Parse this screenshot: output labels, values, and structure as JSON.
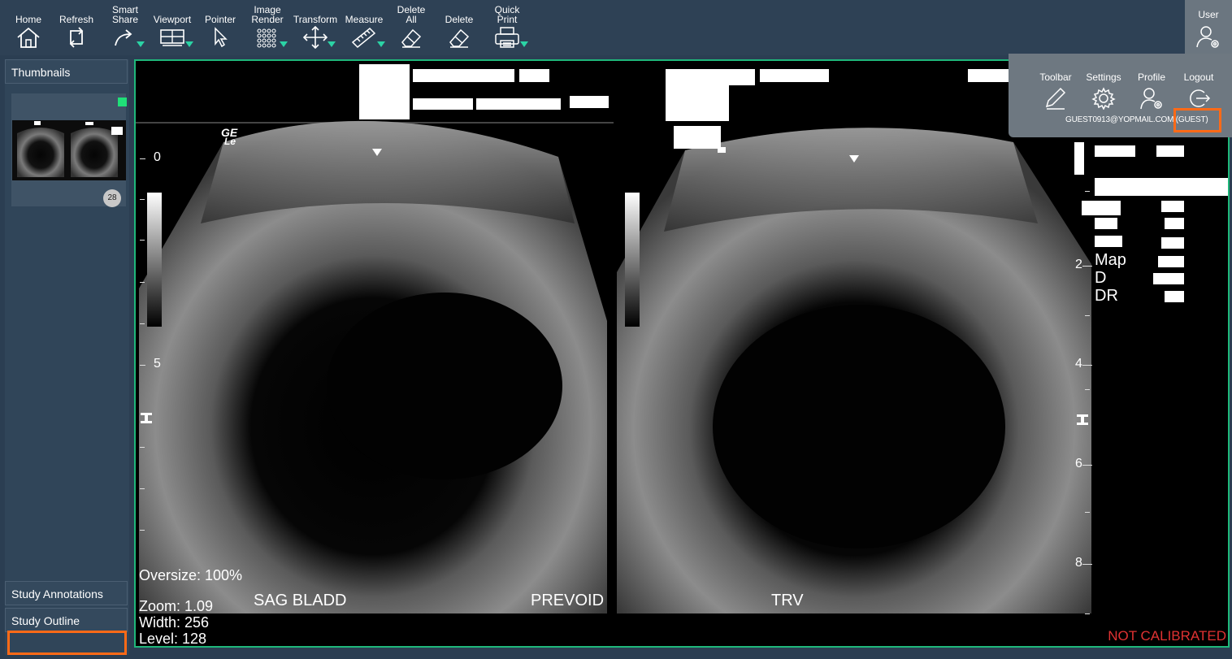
{
  "toolbar": {
    "home": "Home",
    "refresh": "Refresh",
    "smart_share": "Smart\nShare",
    "viewport": "Viewport",
    "pointer": "Pointer",
    "image_render": "Image\nRender",
    "transform": "Transform",
    "measure": "Measure",
    "delete_all": "Delete\nAll",
    "delete": "Delete",
    "quick_print": "Quick\nPrint",
    "user": "User"
  },
  "user_menu": {
    "toolbar": "Toolbar",
    "settings": "Settings",
    "profile": "Profile",
    "logout": "Logout",
    "email": "GUEST0913@YOPMAIL.COM (GUEST)"
  },
  "left_panel": {
    "thumbnails": "Thumbnails",
    "thumb_count": "28",
    "study_annotations": "Study Annotations",
    "study_outline": "Study Outline"
  },
  "viewer": {
    "vendor_logo": "GE",
    "vendor_sub": "Le",
    "oversize": "Oversize: 100%",
    "zoom": "Zoom: 1.09",
    "width": "Width: 256",
    "level": "Level: 128",
    "label_left": "SAG BLADD",
    "label_prevoid": "PREVOID",
    "label_right": "TRV",
    "left_scale": [
      "0",
      "5"
    ],
    "right_scale": [
      "2",
      "4",
      "6",
      "8"
    ],
    "param_labels": [
      "Map",
      "D",
      "DR"
    ],
    "not_calibrated": "NOT CALIBRATED",
    "colors": {
      "frame": "#1fb77a",
      "accent": "#2bd3a5",
      "highlight": "#ff6a17",
      "warning": "#e03232"
    }
  }
}
